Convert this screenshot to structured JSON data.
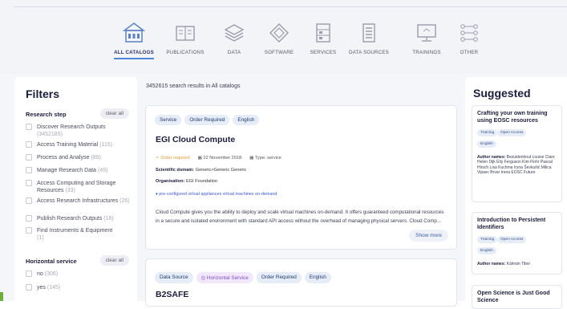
{
  "categories": [
    {
      "label": "ALL CATALOGS",
      "icon": "catalog-building-icon",
      "active": true
    },
    {
      "label": "PUBLICATIONS",
      "icon": "book-icon",
      "active": false
    },
    {
      "label": "DATA",
      "icon": "layers-icon",
      "active": false
    },
    {
      "label": "SOFTWARE",
      "icon": "cube-icon",
      "active": false
    },
    {
      "label": "SERVICES",
      "icon": "server-icon",
      "active": false
    },
    {
      "label": "DATA SOURCES",
      "icon": "database-icon",
      "active": false
    },
    {
      "label": "TRAININGS",
      "icon": "monitor-icon",
      "active": false
    },
    {
      "label": "OTHER",
      "icon": "nodes-icon",
      "active": false
    }
  ],
  "filters": {
    "title": "Filters",
    "research_step": {
      "label": "Research step",
      "clear": "clear all",
      "items": [
        {
          "label": "Discover Research Outputs",
          "count": "(3452185)"
        },
        {
          "label": "Access Training Material",
          "count": "(116)"
        },
        {
          "label": "Process and Analyse",
          "count": "(89)"
        },
        {
          "label": "Manage Research Data",
          "count": "(49)"
        },
        {
          "label": "Access Computing and Storage Resources",
          "count": "(33)"
        },
        {
          "label": "Access Research Infrastructures",
          "count": "(26)"
        },
        {
          "label": "Publish Research Outputs",
          "count": "(16)"
        },
        {
          "label": "Find Instruments & Equipment",
          "count": "(1)"
        }
      ]
    },
    "horizontal_service": {
      "label": "Horizontal service",
      "clear": "clear all",
      "items": [
        {
          "label": "no",
          "count": "(306)"
        },
        {
          "label": "yes",
          "count": "(145)"
        }
      ]
    }
  },
  "results": {
    "summary": "3452615 search results in All catalogs"
  },
  "card1": {
    "tags": [
      "Service",
      "Order Required",
      "English"
    ],
    "title": "EGI Cloud Compute",
    "order": "Order required",
    "date": "22 November 2018",
    "type": "Type: service",
    "domain_label": "Scientific domain:",
    "domain_value": "Generic>Generic Generic",
    "org_label": "Organisation:",
    "org_value": "EGI Foundation",
    "links": "pre-configured virtual appliances   virtual machines on-demand",
    "description": "Cloud Compute gives you the ability to deploy and scale virtual machines on-demand. It offers guaranteed computational resources in a secure and isolated environment with standard API access without the overhead of managing physical servers. Cloud Comp...",
    "more": "Show more"
  },
  "card2": {
    "tags": [
      "Data Source",
      "Horizontal Service",
      "Order Required",
      "English"
    ],
    "title": "B2SAFE"
  },
  "suggested": {
    "title": "Suggested",
    "items": [
      {
        "title": "Crafting your own training using EOSC resources",
        "tags": [
          "Training",
          "Open Access",
          "English"
        ],
        "authors_label": "Author names:",
        "authors": "Bezuidenhout Louise Clare Helen Dijk Elly Ferguson Kim Flohr Pascal Hirsch Lisa Kuchma Iryna Ševkušić Milica Vipavc Brvar Irena EOSC Future"
      },
      {
        "title": "Introduction to Persistent Identifiers",
        "tags": [
          "Training",
          "Open Access",
          "English"
        ],
        "authors_label": "Author names:",
        "authors": "Kálmán Tibor"
      },
      {
        "title": "Open Science is Just Good Science"
      }
    ]
  },
  "colors": {
    "accent": "#4d8ad6",
    "order": "#e39a33",
    "horizontal": "#7f4bc4",
    "link": "#3d59c9"
  }
}
